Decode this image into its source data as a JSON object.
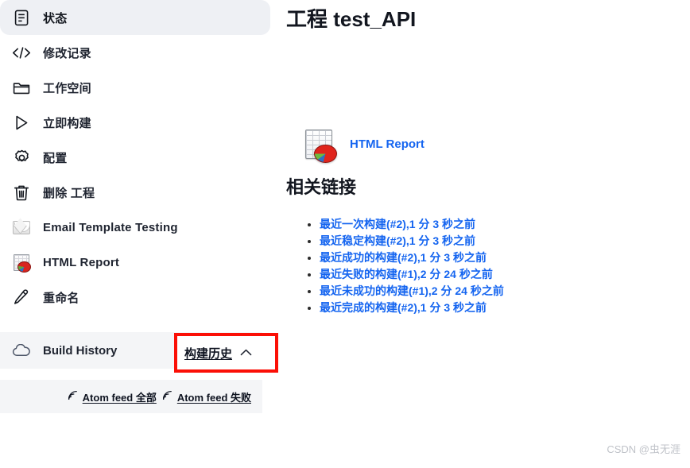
{
  "sidebar": {
    "items": [
      {
        "label": "状态",
        "icon": "document-status-icon",
        "active": true
      },
      {
        "label": "修改记录",
        "icon": "code-brackets-icon",
        "active": false
      },
      {
        "label": "工作空间",
        "icon": "folder-icon",
        "active": false
      },
      {
        "label": "立即构建",
        "icon": "play-triangle-icon",
        "active": false
      },
      {
        "label": "配置",
        "icon": "gear-icon",
        "active": false
      },
      {
        "label": "删除 工程",
        "icon": "trash-icon",
        "active": false
      },
      {
        "label": "Email Template Testing",
        "icon": "mail-envelope-icon",
        "active": false
      },
      {
        "label": "HTML Report",
        "icon": "html-report-icon",
        "active": false
      },
      {
        "label": "重命名",
        "icon": "pencil-icon",
        "active": false
      }
    ],
    "build_history": {
      "label": "Build History",
      "icon": "cloud-icon",
      "link_label": "构建历史",
      "collapse_icon": "chevron-up-icon",
      "highlight_color": "#fb0f06"
    },
    "atom_feeds": [
      {
        "label": "Atom feed 全部",
        "icon": "rss-icon"
      },
      {
        "label": "Atom feed 失败",
        "icon": "rss-icon"
      }
    ]
  },
  "main": {
    "title": "工程 test_API",
    "report": {
      "icon": "html-report-icon",
      "link_label": "HTML Report"
    },
    "related_heading": "相关链接",
    "related_links": [
      "最近一次构建(#2),1 分 3 秒之前",
      "最近稳定构建(#2),1 分 3 秒之前",
      "最近成功的构建(#2),1 分 3 秒之前",
      "最近失败的构建(#1),2 分 24 秒之前",
      "最近未成功的构建(#1),2 分 24 秒之前",
      "最近完成的构建(#2),1 分 3 秒之前"
    ],
    "link_color": "#1565f0"
  },
  "watermark": "CSDN @虫无涯"
}
